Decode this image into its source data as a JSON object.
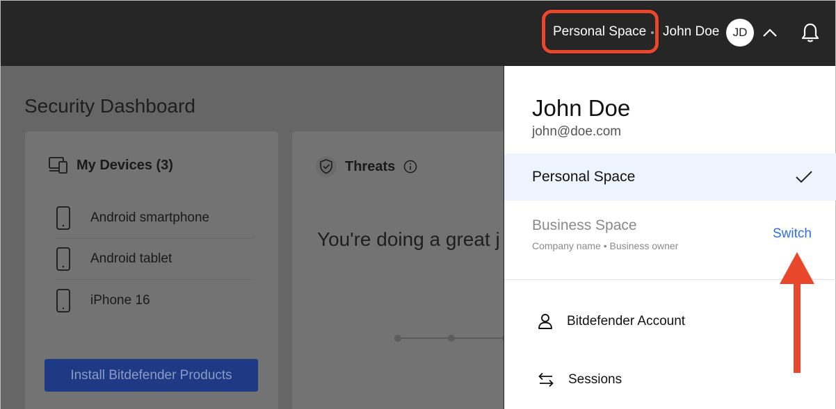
{
  "topbar": {
    "space_label": "Personal Space",
    "user_name": "John Doe",
    "avatar_initials": "JD"
  },
  "main": {
    "page_title": "Security Dashboard",
    "devices_card": {
      "title": "My Devices (3)",
      "devices": [
        {
          "name": "Android smartphone"
        },
        {
          "name": "Android tablet"
        },
        {
          "name": "iPhone 16"
        }
      ],
      "install_button": "Install Bitdefender Products"
    },
    "threats_card": {
      "title": "Threats",
      "message": "You're doing a great j"
    }
  },
  "panel": {
    "user_name": "John Doe",
    "email": "john@doe.com",
    "spaces": [
      {
        "name": "Personal Space",
        "selected": true
      },
      {
        "name": "Business Space",
        "subtitle": "Company name • Business owner",
        "action": "Switch"
      }
    ],
    "menu": [
      {
        "label": "Bitdefender Account",
        "icon": "person-icon"
      },
      {
        "label": "Sessions",
        "icon": "swap-arrows-icon"
      }
    ]
  },
  "colors": {
    "topbar_bg": "#262626",
    "highlight": "#e8472b",
    "accent_link": "#2f6ee0",
    "selected_row_bg": "#eef4fd"
  }
}
